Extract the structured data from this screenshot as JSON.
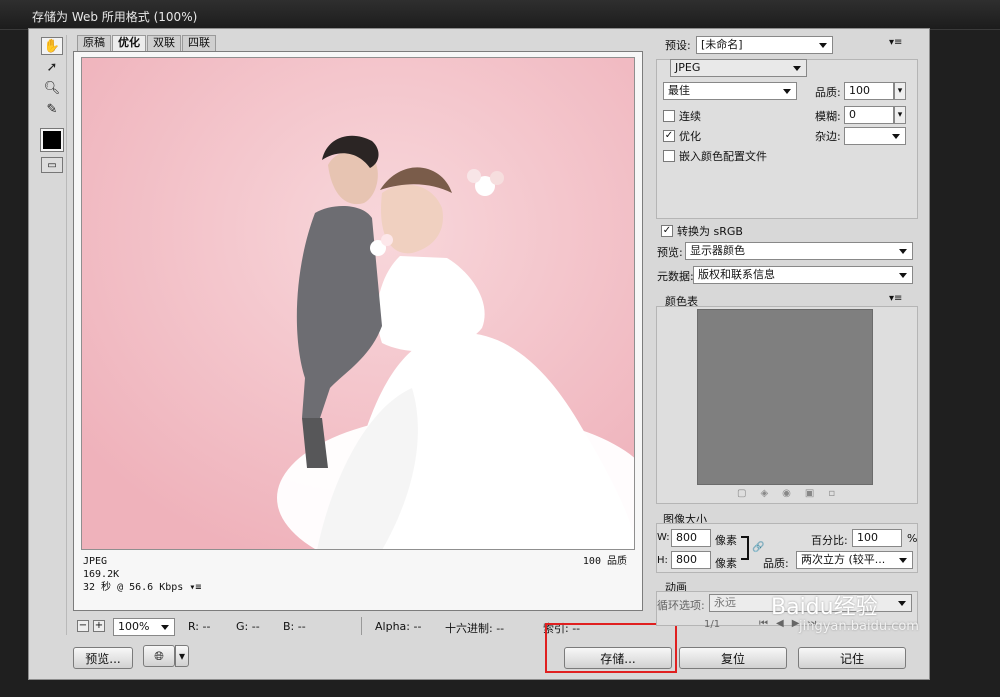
{
  "window_title": "存储为 Web 所用格式 (100%)",
  "tabs": [
    "原稿",
    "优化",
    "双联",
    "四联"
  ],
  "active_tab": "优化",
  "preview_info": {
    "format": "JPEG",
    "size": "169.2K",
    "time": "32 秒 @ 56.6 Kbps",
    "quality_label": "100 品质"
  },
  "preset": {
    "label": "预设:",
    "value": "[未命名]"
  },
  "format_select": "JPEG",
  "quality_preset": "最佳",
  "quality": {
    "label": "品质:",
    "value": "100"
  },
  "blur": {
    "label": "模糊:",
    "value": "0"
  },
  "matte": {
    "label": "杂边:",
    "value": ""
  },
  "checkboxes": {
    "progressive": "连续",
    "optimized": "优化",
    "embed_profile": "嵌入颜色配置文件",
    "convert_srgb": "转换为 sRGB"
  },
  "preview": {
    "label": "预览:",
    "value": "显示器颜色"
  },
  "metadata": {
    "label": "元数据:",
    "value": "版权和联系信息"
  },
  "color_table": {
    "title": "颜色表"
  },
  "image_size": {
    "title": "图像大小",
    "w_label": "W:",
    "h_label": "H:",
    "width": "800",
    "height": "800",
    "unit": "像素",
    "percent_label": "百分比:",
    "percent": "100",
    "percent_unit": "%",
    "quality_label": "品质:",
    "quality_value": "两次立方 (较平..."
  },
  "animation": {
    "title": "动画",
    "loop_label": "循环选项:",
    "loop_value": "永远",
    "frame": "1/1"
  },
  "bottom_bar": {
    "zoom": "100%",
    "r": "R: --",
    "g": "G: --",
    "b": "B: --",
    "alpha": "Alpha: --",
    "hex": "十六进制: --",
    "index": "索引: --"
  },
  "buttons": {
    "preview": "预览...",
    "save": "存储...",
    "reset": "复位",
    "remember": "记住"
  },
  "watermark": {
    "text": "Baidu经验",
    "subtext": "jingyan.baidu.com"
  }
}
